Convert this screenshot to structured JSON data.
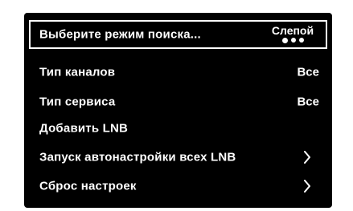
{
  "menu": {
    "search_mode": {
      "label": "Выберите режим поиска...",
      "value": "Слепой",
      "option_count": 3,
      "selected_option_index": 0
    },
    "channel_type": {
      "label": "Тип каналов",
      "value": "Все"
    },
    "service_type": {
      "label": "Тип сервиса",
      "value": "Все"
    },
    "add_lnb": {
      "label": "Добавить LNB"
    },
    "auto_tune_all_lnb": {
      "label": "Запуск автонастройки всех LNB",
      "icon": "chevron-right-icon"
    },
    "reset_settings": {
      "label": "Сброс настроек",
      "icon": "chevron-right-icon"
    }
  },
  "colors": {
    "background": "#000000",
    "text": "#ffffff",
    "selection_border": "#ffffff",
    "page": "#ffffff"
  }
}
